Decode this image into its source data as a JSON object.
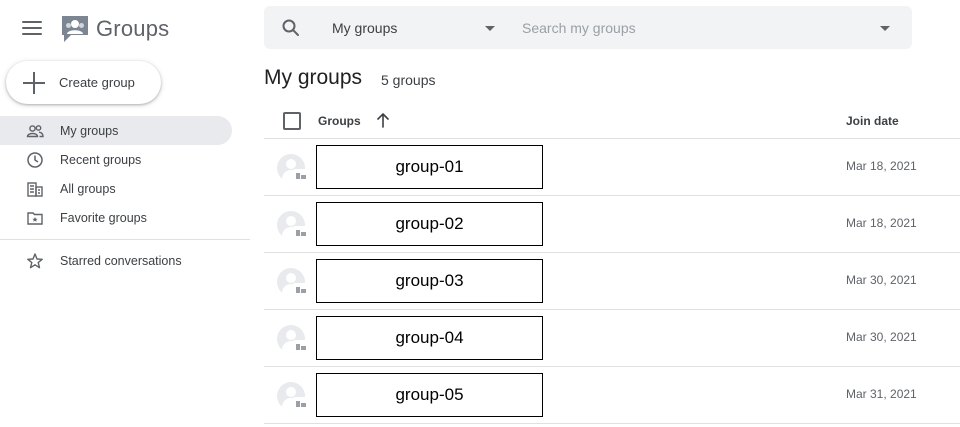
{
  "app": {
    "title": "Groups",
    "logo": "google-groups-logo-icon"
  },
  "sidebar": {
    "create_label": "Create group",
    "items": [
      {
        "label": "My groups",
        "icon": "people-icon",
        "active": true
      },
      {
        "label": "Recent groups",
        "icon": "clock-icon",
        "active": false
      },
      {
        "label": "All groups",
        "icon": "building-icon",
        "active": false
      },
      {
        "label": "Favorite groups",
        "icon": "folder-star-icon",
        "active": false
      }
    ],
    "starred_label": "Starred conversations"
  },
  "search": {
    "scope_value": "My groups",
    "placeholder": "Search my groups"
  },
  "main": {
    "title": "My groups",
    "count": "5 groups",
    "columns": {
      "groups": "Groups",
      "join_date": "Join date"
    },
    "rows": [
      {
        "name": "group-01",
        "join_date": "Mar 18, 2021"
      },
      {
        "name": "group-02",
        "join_date": "Mar 18, 2021"
      },
      {
        "name": "group-03",
        "join_date": "Mar 30, 2021"
      },
      {
        "name": "group-04",
        "join_date": "Mar 30, 2021"
      },
      {
        "name": "group-05",
        "join_date": "Mar 31, 2021"
      }
    ]
  },
  "colors": {
    "active_nav_bg": "#e8eaed",
    "searchbar_bg": "#f1f3f4",
    "icon_gray": "#5f6368"
  }
}
